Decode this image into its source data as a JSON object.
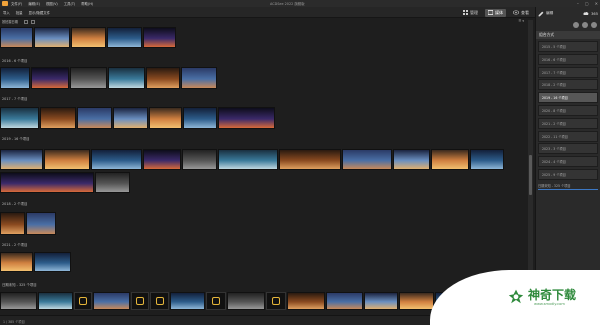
{
  "window": {
    "title": "ACDSee 2022 旗舰版",
    "menu": [
      "文件(F)",
      "编辑(E)",
      "视图(V)",
      "工具(T)",
      "帮助(H)"
    ],
    "controls": [
      "–",
      "▢",
      "✕"
    ]
  },
  "toolbar": {
    "small_tools": [
      "导入",
      "批量",
      "显示/隐藏文件"
    ],
    "modes": [
      {
        "label": "管理",
        "icon": "grid-icon",
        "active": false
      },
      {
        "label": "媒体",
        "icon": "media-icon",
        "active": true
      },
      {
        "label": "查看",
        "icon": "eye-icon",
        "active": false
      }
    ]
  },
  "subbar": {
    "sort": "按拍摄日期",
    "zoom": "☰ ▾"
  },
  "groups": [
    {
      "label": ""
    },
    {
      "label": "2016 - 6 个项目"
    },
    {
      "label": "2017 - 7 个项目"
    },
    {
      "label": "2019 - 16 个项目"
    },
    {
      "label": "2018 - 2 个项目"
    },
    {
      "label": "2021 - 2 个项目"
    },
    {
      "label": "日期未知 - 325 个项目"
    }
  ],
  "sidebar": {
    "tools": [
      {
        "label": "编辑",
        "icon": "edit-icon"
      },
      {
        "label": "365",
        "icon": "cloud-icon"
      }
    ],
    "header": "组合方式",
    "items": [
      {
        "label": "2015 - 5 个项目",
        "active": false
      },
      {
        "label": "2016 - 6 个项目",
        "active": false
      },
      {
        "label": "2017 - 7 个项目",
        "active": false
      },
      {
        "label": "2018 - 2 个项目",
        "active": false
      },
      {
        "label": "2019 - 16 个项目",
        "active": true
      },
      {
        "label": "2020 - 8 个项目",
        "active": false
      },
      {
        "label": "2021 - 2 个项目",
        "active": false
      },
      {
        "label": "2022 - 11 个项目",
        "active": false
      },
      {
        "label": "2023 - 3 个项目",
        "active": false
      },
      {
        "label": "2024 - 4 个项目",
        "active": false
      },
      {
        "label": "2025 - 9 个项目",
        "active": false
      }
    ],
    "progress": "日期未知 - 325 个项目"
  },
  "status": {
    "info": "1 / 385 个项目"
  },
  "watermark": {
    "brand": "神奇下载",
    "url": "www.smxdiy.com"
  }
}
